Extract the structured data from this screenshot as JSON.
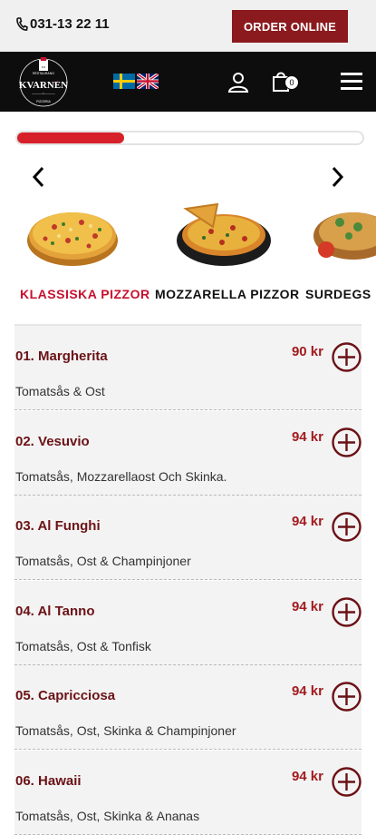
{
  "header": {
    "phone": "031-13 22 11",
    "order_button": "ORDER ONLINE"
  },
  "nav": {
    "logo_text": "KVARNEN",
    "logo_ring_top": "RESTAURANG",
    "logo_ring_bottom": "PIZZERIA",
    "cart_count": "0",
    "icons": [
      "phone-icon",
      "user-icon",
      "cart-icon",
      "menu-icon",
      "flag-sweden",
      "flag-uk"
    ]
  },
  "progress": {
    "value": 0.31,
    "color": "#d6202a"
  },
  "categories": [
    {
      "label": "KLASSISKA PIZZOR",
      "active": true
    },
    {
      "label": "MOZZARELLA PIZZOR",
      "active": false
    },
    {
      "label": "SURDEGS",
      "active": false
    }
  ],
  "menu_items": [
    {
      "name": "01. Margherita",
      "price": "90 kr",
      "desc": "Tomatsås & Ost"
    },
    {
      "name": "02. Vesuvio",
      "price": "94 kr",
      "desc": "Tomatsås, Mozzarellaost Och Skinka."
    },
    {
      "name": "03. Al Funghi",
      "price": "94 kr",
      "desc": "Tomatsås, Ost & Champinjoner"
    },
    {
      "name": "04. Al Tanno",
      "price": "94 kr",
      "desc": "Tomatsås, Ost & Tonfisk"
    },
    {
      "name": "05. Capricciosa",
      "price": "94 kr",
      "desc": "Tomatsås, Ost, Skinka & Champinjoner"
    },
    {
      "name": "06. Hawaii",
      "price": "94 kr",
      "desc": "Tomatsås, Ost, Skinka & Ananas"
    }
  ],
  "colors": {
    "accent": "#8b1a1e",
    "price": "#a31b1f",
    "active_category": "#c8102e"
  }
}
